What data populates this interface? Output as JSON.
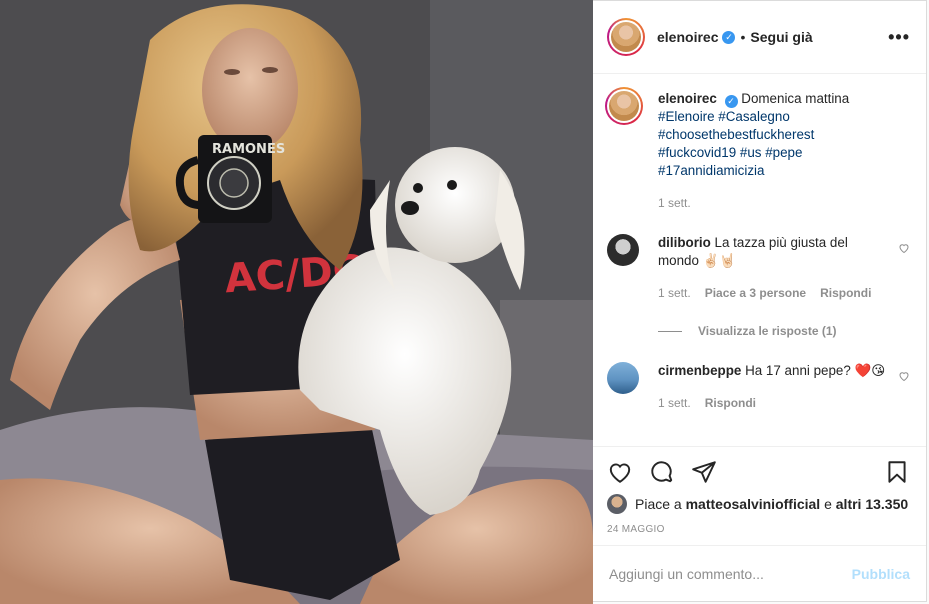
{
  "post": {
    "author": "elenoirec",
    "follow_status": "Segui già",
    "more": "•••",
    "verified_mark": "✓"
  },
  "caption": {
    "user": "elenoirec",
    "text": "Domenica mattina",
    "tags_line1": "#Elenoire #Casalegno",
    "tags_line2": "#choosethebestfuckherest",
    "tags_line3": "#fuckcovid19 #us #pepe",
    "tags_line4": "#17annidiamicizia",
    "time": "1 sett."
  },
  "comments": [
    {
      "user": "diliborio",
      "text": "La tazza più giusta del mondo ✌🏻🤘🏻",
      "time": "1 sett.",
      "likes": "Piace a 3 persone",
      "reply": "Rispondi",
      "view_replies": "Visualizza le risposte (1)"
    },
    {
      "user": "cirmenbeppe",
      "text": "Ha 17 anni pepe? ❤️😘",
      "time": "1 sett.",
      "reply": "Rispondi"
    }
  ],
  "likes": {
    "prefix": "Piace a ",
    "user": "matteosalviniofficial",
    "connector": " e ",
    "others": "altri 13.350"
  },
  "date": "24 MAGGIO",
  "add_comment": {
    "placeholder": "Aggiungi un commento...",
    "post_label": "Pubblica"
  },
  "photo": {
    "mug_text": "RAMONES",
    "shirt_text": "AC/DC"
  },
  "colors": {
    "link": "#00376b",
    "verified": "#3897f0",
    "post_disabled": "#b2dffc",
    "muted": "#8e8e8e"
  }
}
